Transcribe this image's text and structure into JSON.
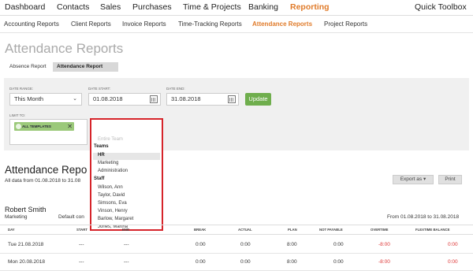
{
  "topnav": {
    "items": [
      "Dashboard",
      "Contacts",
      "Sales",
      "Purchases",
      "Time & Projects",
      "Banking",
      "Reporting"
    ],
    "right": "Quick Toolbox"
  },
  "subnav": {
    "items": [
      "Accounting Reports",
      "Client Reports",
      "Invoice Reports",
      "Time-Tracking Reports",
      "Attendance Reports",
      "Project Reports"
    ]
  },
  "page": {
    "title": "Attendance Reports",
    "tabs": [
      "Absence Report",
      "Attendance Report"
    ]
  },
  "filters": {
    "date_range_label": "DATE RANGE:",
    "date_range_value": "This Month",
    "date_start_label": "DATE START:",
    "date_start_value": "01.08.2018",
    "date_end_label": "DATE END:",
    "date_end_value": "31.08.2018",
    "update_label": "Update",
    "limit_label": "LIMIT TO:",
    "tag_templates": "ALL TEMPLATES",
    "tag_team": "ENTIRE TEAM"
  },
  "dropdown": {
    "placeholder": "Entire Team",
    "teams_header": "Teams",
    "teams": [
      "HR",
      "Marketing",
      "Administration"
    ],
    "staff_header": "Staff",
    "staff": [
      "Wilson, Ann",
      "Taylor, David",
      "Simsons, Eva",
      "Vinson, Henry",
      "Barlow, Margaret",
      "Jones, Martha"
    ]
  },
  "report": {
    "title": "Attendance Repo",
    "subtitle": "All data from 01.08.2018 to 31.08",
    "export_label": "Export as",
    "print_label": "Print"
  },
  "person": {
    "name": "Robert Smith",
    "dept": "Marketing",
    "mid": "Default con",
    "range": "From 01.08.2018 to 31.08.2018"
  },
  "table": {
    "headers": [
      "DAY",
      "START",
      "END",
      "BREAK",
      "ACTUAL",
      "PLAN",
      "NOT PAYABLE",
      "OVERTIME",
      "FLEXTIME BALANCE"
    ],
    "rows": [
      [
        "Tue 21.08.2018",
        "---",
        "---",
        "0:00",
        "0:00",
        "8:00",
        "0:00",
        "-8:00",
        "0:00"
      ],
      [
        "Mon 20.08.2018",
        "---",
        "---",
        "0:00",
        "0:00",
        "8:00",
        "0:00",
        "-8:00",
        "0:00"
      ]
    ]
  },
  "colors": {
    "accent": "#e07b2a",
    "update_button": "#6fae4d",
    "tag_bg": "#9bc97a",
    "dropdown_border": "#d6242a",
    "negative": "#dd3333"
  }
}
